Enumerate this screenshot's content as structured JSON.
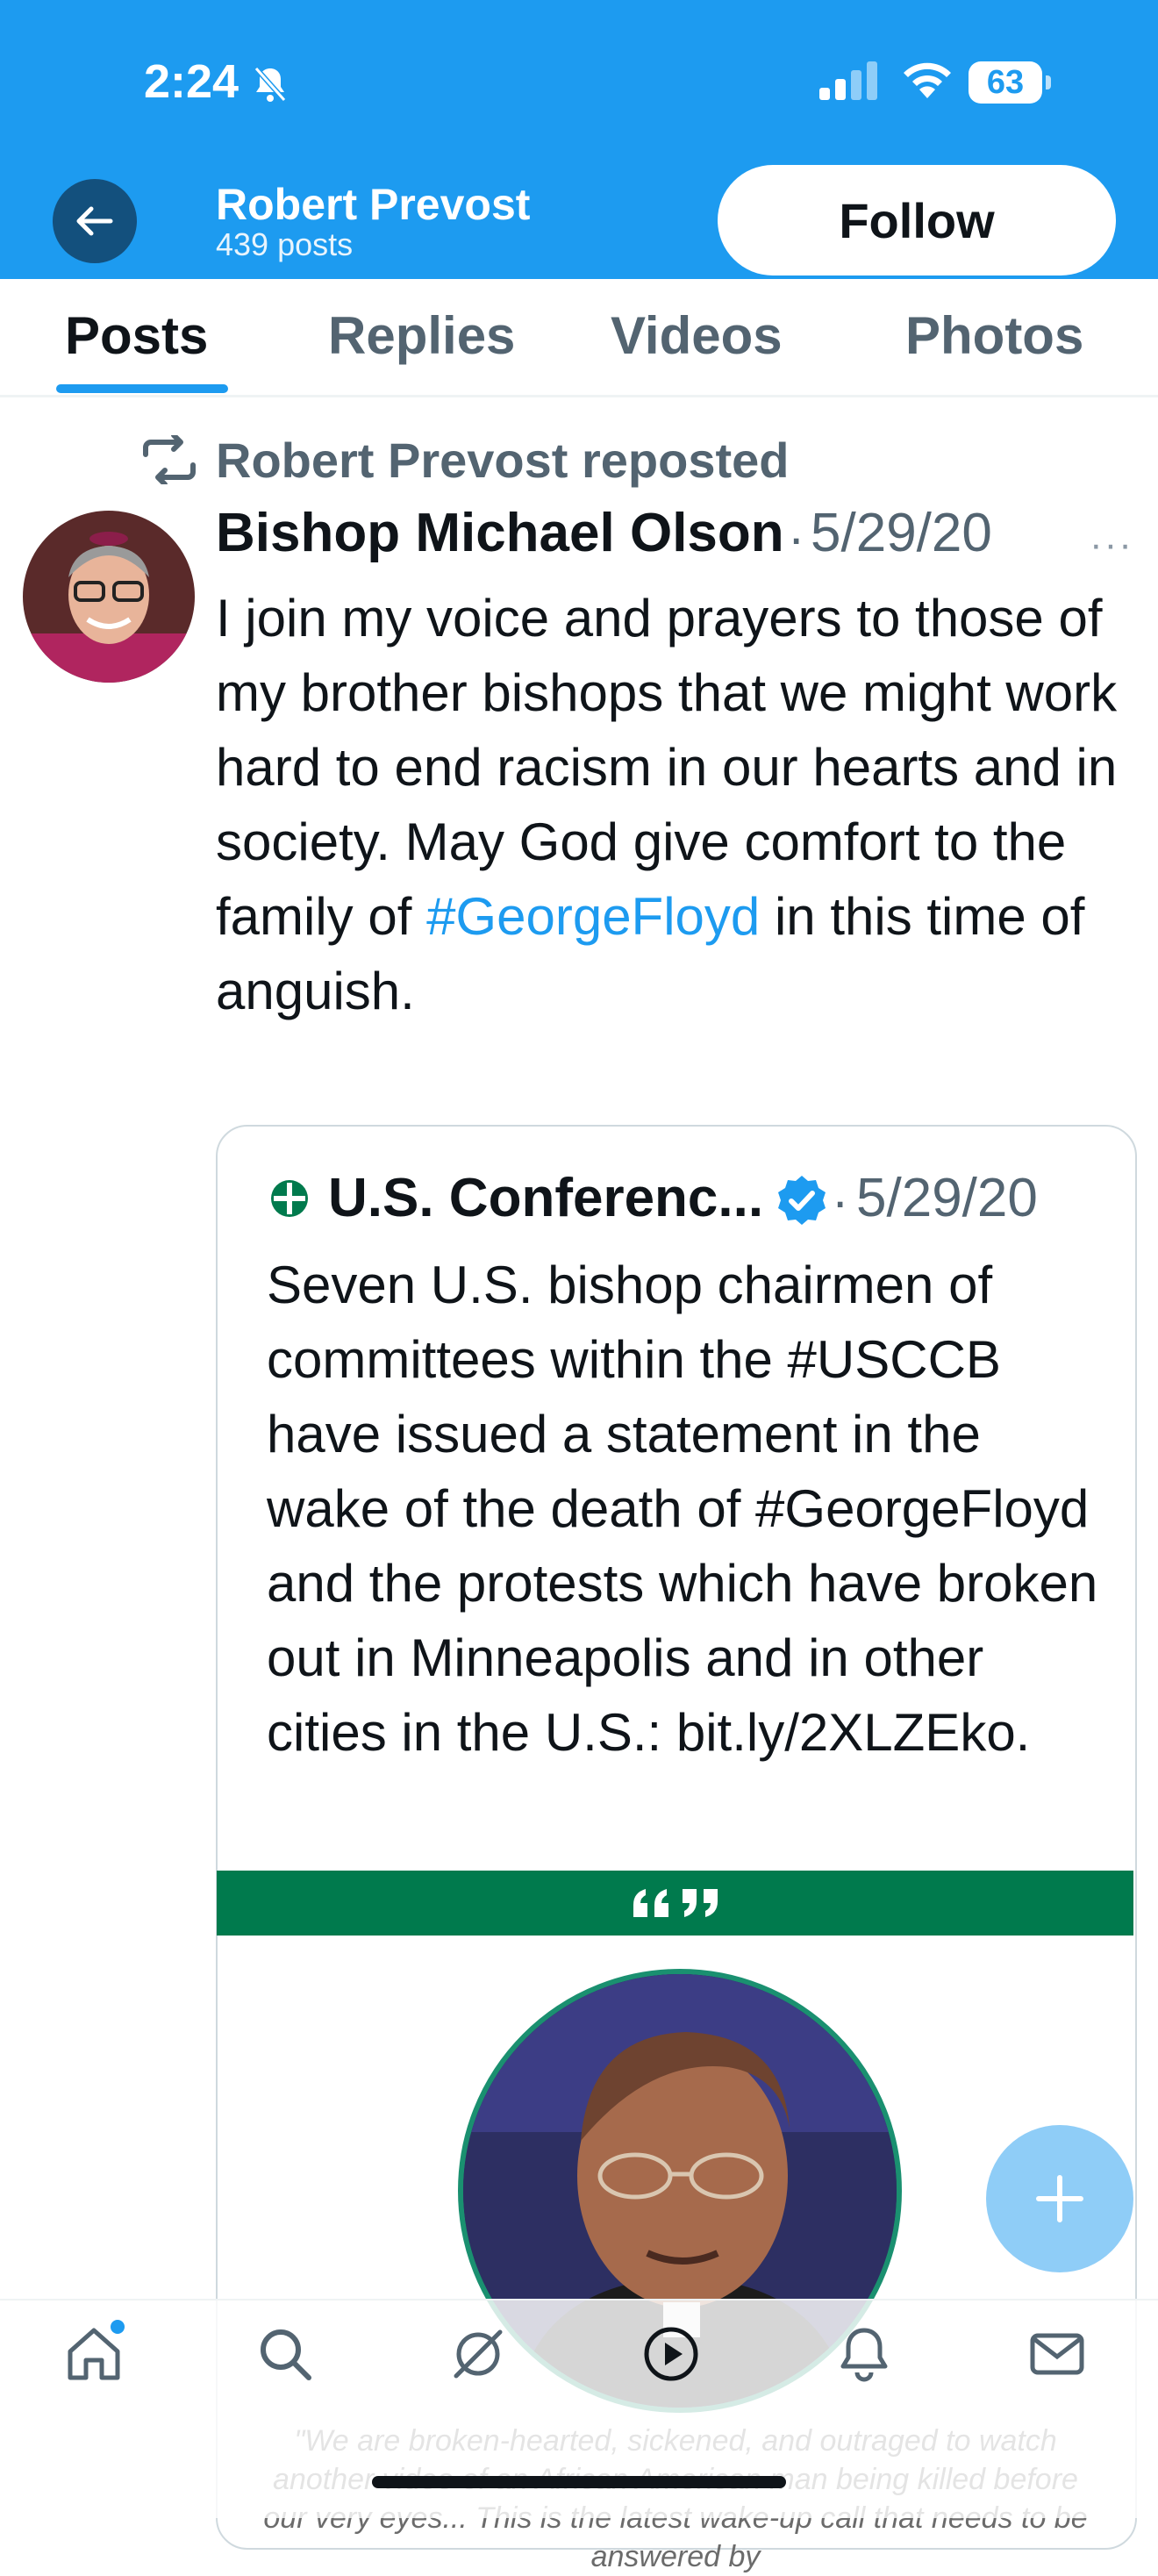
{
  "status_bar": {
    "time": "2:24",
    "battery": "63"
  },
  "header": {
    "name": "Robert Prevost",
    "posts_count": "439 posts",
    "follow_label": "Follow"
  },
  "tabs": [
    {
      "label": "Posts",
      "active": true
    },
    {
      "label": "Replies",
      "active": false
    },
    {
      "label": "Videos",
      "active": false
    },
    {
      "label": "Photos",
      "active": false
    }
  ],
  "post": {
    "repost_label": "Robert Prevost reposted",
    "author": "Bishop Michael Olson",
    "separator": "·",
    "date": "5/29/20",
    "more": "···",
    "text_before": "I join my voice and prayers to those of my brother bishops that we might work hard to end racism in our hearts and in society. May God give comfort to the family of ",
    "hashtag": "#GeorgeFloyd",
    "text_after": " in this time of anguish.",
    "quote": {
      "name": "U.S. Conferenc...",
      "separator": "·",
      "date": "5/29/20",
      "text": "Seven U.S. bishop chairmen of committees within the #USCCB have issued a statement in the wake of the death of #GeorgeFloyd and the protests which have broken out in Minneapolis and in other cities in the U.S.: bit.ly/2XLZEko.",
      "media_caption": "\"We are broken-hearted, sickened, and outraged to watch another video of an African American man being killed before our very eyes... This is the latest wake-up call that needs to be answered by"
    }
  },
  "bottom_nav": [
    "home-icon",
    "search-icon",
    "grok-icon",
    "video-icon",
    "notifications-icon",
    "messages-icon"
  ],
  "colors": {
    "accent": "#1d9bf0",
    "header_bg": "#1d9bf0",
    "band_green": "#007a4d",
    "secondary_text": "#536471"
  }
}
